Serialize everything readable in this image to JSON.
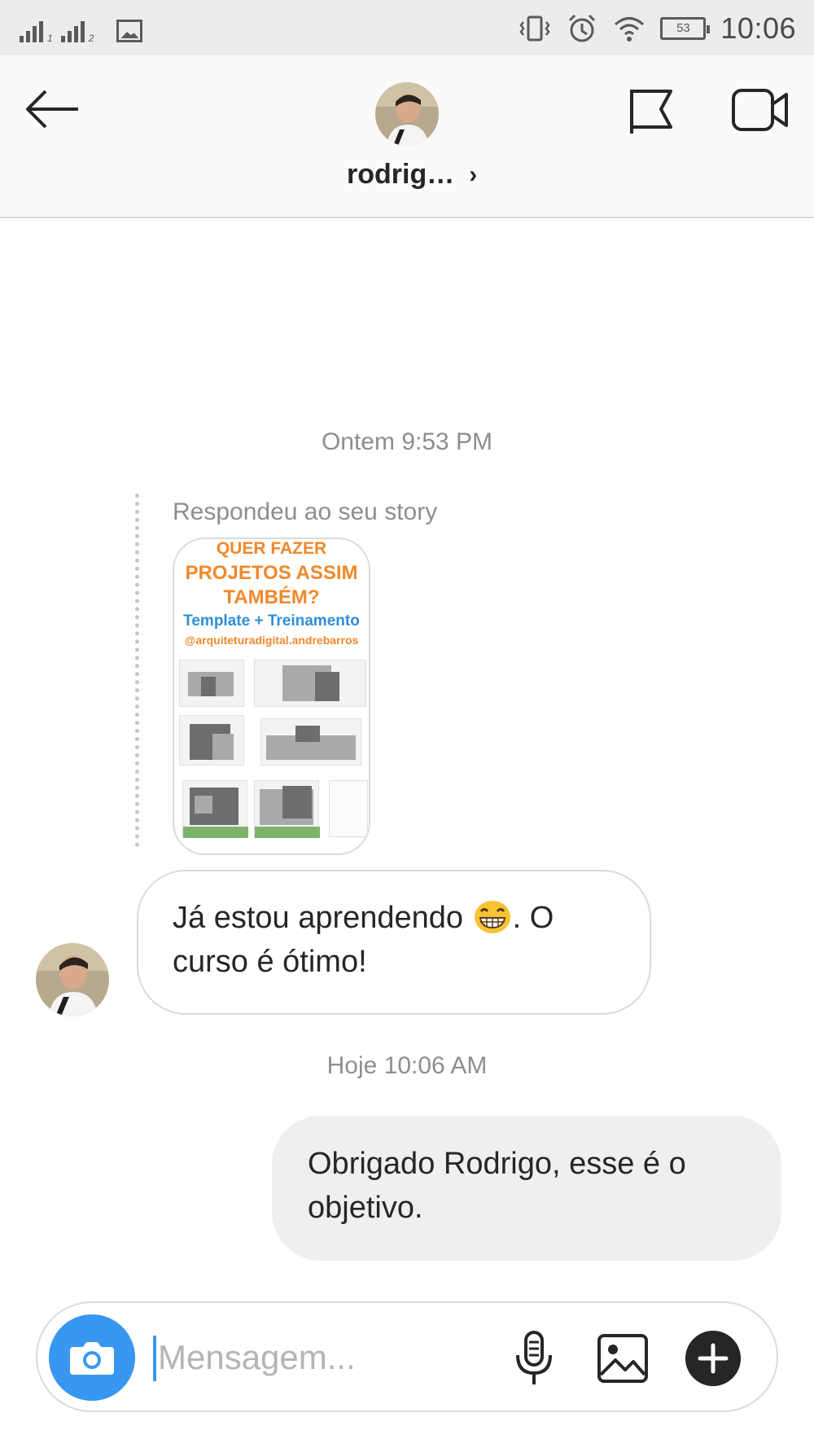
{
  "status_bar": {
    "time": "10:06",
    "battery": "53",
    "sim1_label": "1",
    "sim2_label": "2",
    "icons": [
      "signal-sim1-icon",
      "signal-sim2-icon",
      "gallery-notification-icon",
      "vibrate-icon",
      "alarm-icon",
      "wifi-icon",
      "battery-icon"
    ]
  },
  "header": {
    "contact_name": "rodrig…",
    "chevron": "›",
    "icons": [
      "back-arrow-icon",
      "avatar",
      "flag-icon",
      "video-call-icon"
    ]
  },
  "chat": {
    "timestamp_1": "Ontem 9:53 PM",
    "story_reply_label": "Respondeu ao seu story",
    "story": {
      "line1": "QUER FAZER",
      "line2": "PROJETOS ASSIM",
      "line3": "TAMBÉM?",
      "subtitle": "Template + Treinamento",
      "handle": "@arquiteturadigital.andrebarros"
    },
    "incoming_message": "Já estou aprendendo",
    "incoming_message_tail": ". O curso é ótimo!",
    "timestamp_2": "Hoje 10:06 AM",
    "outgoing_message": "Obrigado Rodrigo, esse é o objetivo."
  },
  "composer": {
    "placeholder": "Mensagem...",
    "icons": [
      "camera-icon",
      "microphone-icon",
      "gallery-icon",
      "plus-icon"
    ]
  },
  "colors": {
    "accent": "#3897f0",
    "story_orange": "#f0892a",
    "story_blue": "#2f8fd6",
    "outgoing_bubble": "#efefef",
    "status_bar_bg": "#ececec",
    "header_bg": "#fafafa"
  }
}
